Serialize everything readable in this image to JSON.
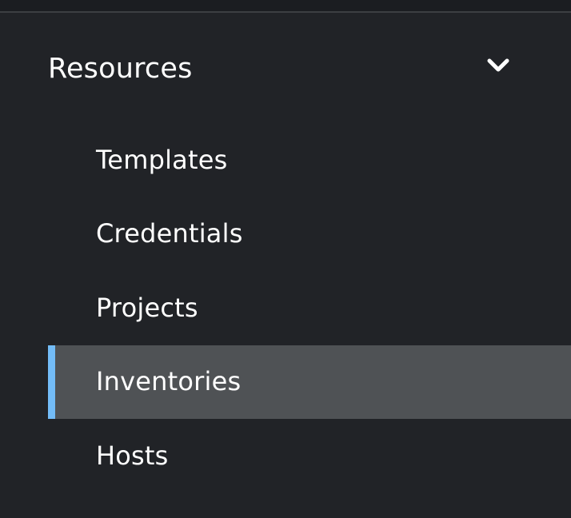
{
  "section": {
    "title": "Resources",
    "expanded": true,
    "toggle_icon": "chevron-down-icon"
  },
  "nav": {
    "items": [
      {
        "label": "Templates",
        "active": false
      },
      {
        "label": "Credentials",
        "active": false
      },
      {
        "label": "Projects",
        "active": false
      },
      {
        "label": "Inventories",
        "active": true
      },
      {
        "label": "Hosts",
        "active": false
      }
    ]
  },
  "colors": {
    "background": "#212327",
    "active_background": "#4f5255",
    "active_accent": "#73bcf7",
    "text": "#ffffff"
  }
}
